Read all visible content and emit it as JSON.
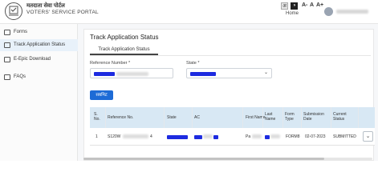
{
  "header": {
    "portal_hindi": "मतदाता सेवा पोर्टल",
    "portal_en": "VOTERS' SERVICE PORTAL",
    "lang_box": "अ",
    "font_small": "A-",
    "font_normal": "A",
    "font_large": "A+",
    "home": "Home",
    "logo_icon": "eci-logo-icon",
    "toggle_glyph": "◑"
  },
  "sidebar": {
    "items": [
      {
        "label": "Forms",
        "icon": "forms-icon"
      },
      {
        "label": "Track Application Status",
        "icon": "track-icon",
        "active": true
      },
      {
        "label": "E-Epic Download",
        "icon": "download-icon"
      },
      {
        "label": "FAQs",
        "icon": "faq-icon"
      }
    ]
  },
  "main": {
    "title": "Track Application Status",
    "tab": "Track Application Status",
    "reference_label": "Reference Number *",
    "state_label": "State *",
    "state_dropdown_icon": "chevron-down-icon",
    "submit": "सबमिट"
  },
  "table": {
    "headers": [
      "S. No.",
      "Reference No.",
      "State",
      "AC",
      "First Name",
      "Last Name",
      "Form Type",
      "Submission Date",
      "Current Status"
    ],
    "rows": [
      {
        "sno": "1",
        "reference_prefix": "S120W",
        "reference_suffix": "4",
        "first_name_prefix": "Pa",
        "form_type": "FORM8",
        "submission_date": "02-07-2023",
        "status": "SUBMITTED"
      }
    ],
    "expand_icon": "chevron-down-icon",
    "expand_glyph": "⌄"
  }
}
